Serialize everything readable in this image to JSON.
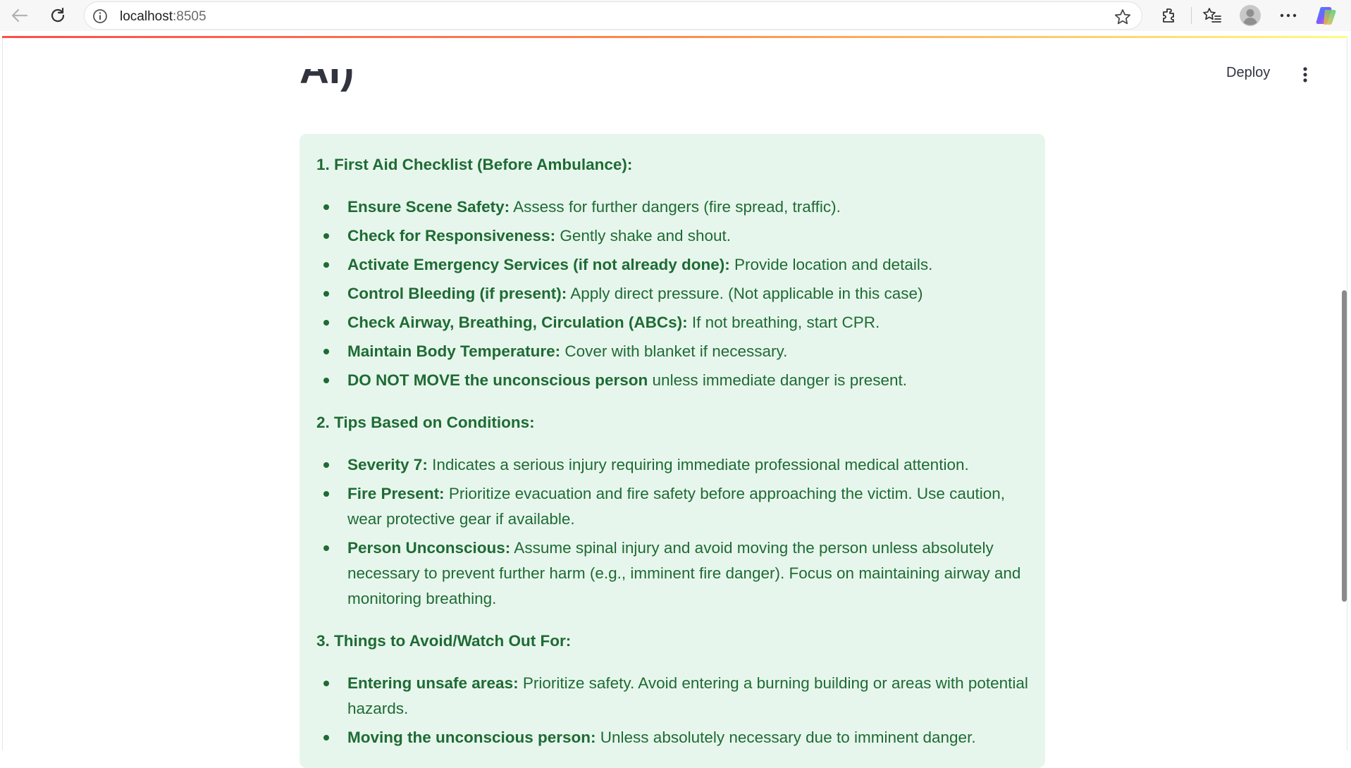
{
  "browser": {
    "url_host": "localhost",
    "url_port": ":8505"
  },
  "app": {
    "deploy_label": "Deploy",
    "heading_fragment": "AI)"
  },
  "content": {
    "sections": [
      {
        "title": "1. First Aid Checklist (Before Ambulance):",
        "items": [
          {
            "bold": "Ensure Scene Safety:",
            "text": " Assess for further dangers (fire spread, traffic)."
          },
          {
            "bold": "Check for Responsiveness:",
            "text": " Gently shake and shout."
          },
          {
            "bold": "Activate Emergency Services (if not already done):",
            "text": " Provide location and details."
          },
          {
            "bold": "Control Bleeding (if present):",
            "text": " Apply direct pressure. (Not applicable in this case)"
          },
          {
            "bold": "Check Airway, Breathing, Circulation (ABCs):",
            "text": " If not breathing, start CPR."
          },
          {
            "bold": "Maintain Body Temperature:",
            "text": " Cover with blanket if necessary."
          },
          {
            "bold": "DO NOT MOVE the unconscious person",
            "text": " unless immediate danger is present."
          }
        ]
      },
      {
        "title": "2. Tips Based on Conditions:",
        "items": [
          {
            "bold": "Severity 7:",
            "text": " Indicates a serious injury requiring immediate professional medical attention."
          },
          {
            "bold": "Fire Present:",
            "text": " Prioritize evacuation and fire safety before approaching the victim. Use caution, wear protective gear if available."
          },
          {
            "bold": "Person Unconscious:",
            "text": " Assume spinal injury and avoid moving the person unless absolutely necessary to prevent further harm (e.g., imminent fire danger). Focus on maintaining airway and monitoring breathing."
          }
        ]
      },
      {
        "title": "3. Things to Avoid/Watch Out For:",
        "items": [
          {
            "bold": "Entering unsafe areas:",
            "text": " Prioritize safety. Avoid entering a burning building or areas with potential hazards."
          },
          {
            "bold": "Moving the unconscious person:",
            "text": " Unless absolutely necessary due to imminent danger."
          }
        ]
      }
    ]
  },
  "colors": {
    "success_bg": "#e7f6ec",
    "success_text": "#1e6b34",
    "header_gradient_start": "#ff4b4b",
    "header_gradient_end": "#fffd80"
  },
  "icons": {
    "back": "back-arrow-icon",
    "reload": "reload-icon",
    "site_info": "info-icon",
    "favorite": "star-icon",
    "extensions": "puzzle-icon",
    "favorites_list": "favorites-icon",
    "profile": "avatar-icon",
    "more": "more-dots-icon",
    "copilot": "copilot-icon",
    "main_menu": "kebab-menu-icon"
  }
}
